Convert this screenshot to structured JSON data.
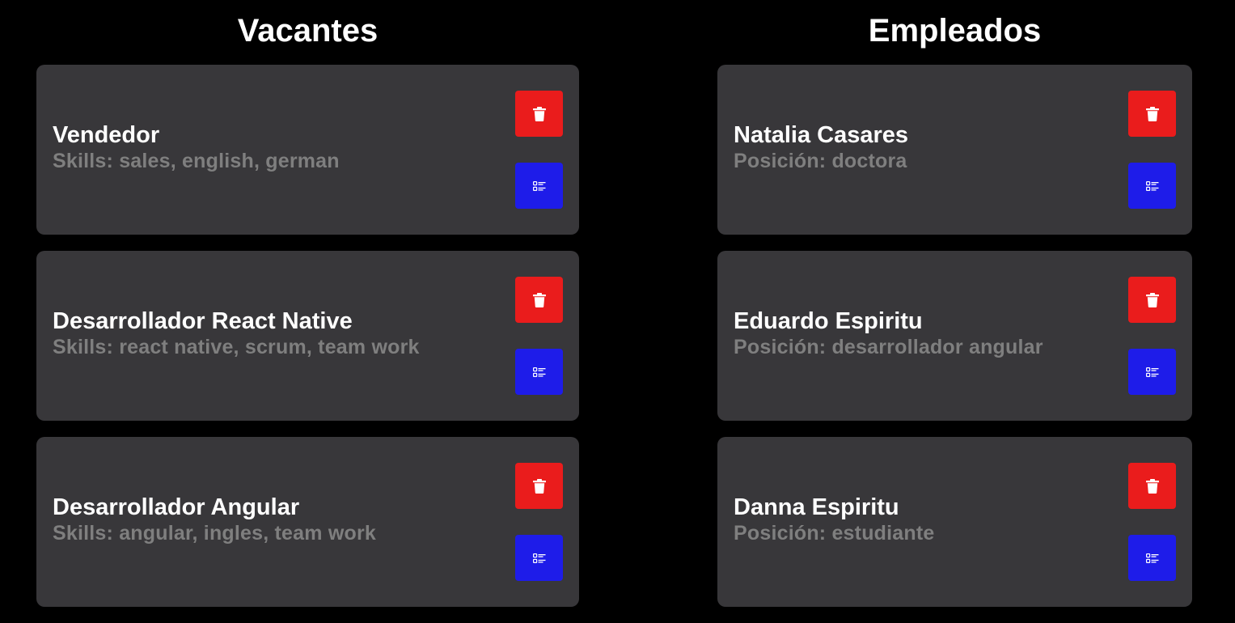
{
  "vacantes": {
    "title": "Vacantes",
    "items": [
      {
        "title": "Vendedor",
        "subtitle": "Skills: sales, english, german"
      },
      {
        "title": "Desarrollador React Native",
        "subtitle": "Skills: react native, scrum, team work"
      },
      {
        "title": "Desarrollador Angular",
        "subtitle": "Skills: angular, ingles, team work"
      }
    ]
  },
  "empleados": {
    "title": "Empleados",
    "items": [
      {
        "title": "Natalia Casares",
        "subtitle": "Posición: doctora"
      },
      {
        "title": "Eduardo Espiritu",
        "subtitle": "Posición: desarrollador angular"
      },
      {
        "title": "Danna Espiritu",
        "subtitle": "Posición: estudiante"
      }
    ]
  },
  "icons": {
    "delete": "trash-icon",
    "detail": "list-icon"
  },
  "colors": {
    "background": "#000000",
    "card": "#38373a",
    "delete_button": "#ea1c1c",
    "detail_button": "#1e1ce9",
    "subtitle": "#7f7f7f"
  }
}
